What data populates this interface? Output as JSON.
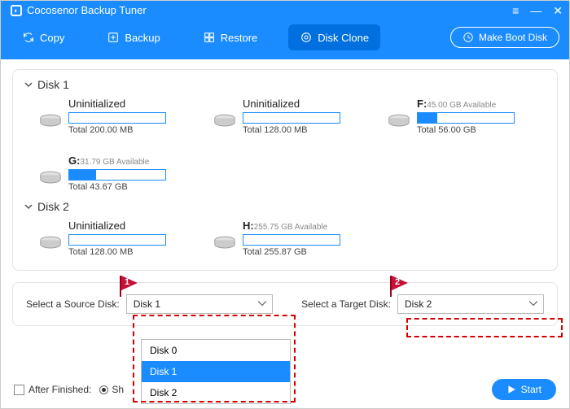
{
  "header": {
    "title": "Cocosenor Backup Tuner",
    "tabs": [
      "Copy",
      "Backup",
      "Restore",
      "Disk Clone"
    ],
    "boot_button": "Make Boot Disk"
  },
  "disks": [
    {
      "name": "Disk 1",
      "volumes": [
        {
          "title": "Uninitialized",
          "total": "Total 200.00 MB",
          "fill": 0
        },
        {
          "title": "Uninitialized",
          "total": "Total 128.00 MB",
          "fill": 0
        },
        {
          "letter": "F:",
          "avail": "45.00 GB Available",
          "total": "Total 56.00 GB",
          "fill": 20
        },
        {
          "letter": "G:",
          "avail": "31.79 GB Available",
          "total": "Total 43.67 GB",
          "fill": 28
        }
      ]
    },
    {
      "name": "Disk 2",
      "volumes": [
        {
          "title": "Uninitialized",
          "total": "Total 128.00 MB",
          "fill": 0
        },
        {
          "letter": "H:",
          "avail": "255.75 GB Available",
          "total": "Total 255.87 GB",
          "fill": 0
        }
      ]
    }
  ],
  "selection": {
    "source_label": "Select a Source Disk:",
    "source_value": "Disk 1",
    "target_label": "Select a Target Disk:",
    "target_value": "Disk 2",
    "options": [
      "Disk 0",
      "Disk 1",
      "Disk 2"
    ]
  },
  "callouts": [
    "1",
    "2"
  ],
  "footer": {
    "after_label": "After Finished:",
    "radio1": "Sh",
    "start": "Start"
  }
}
